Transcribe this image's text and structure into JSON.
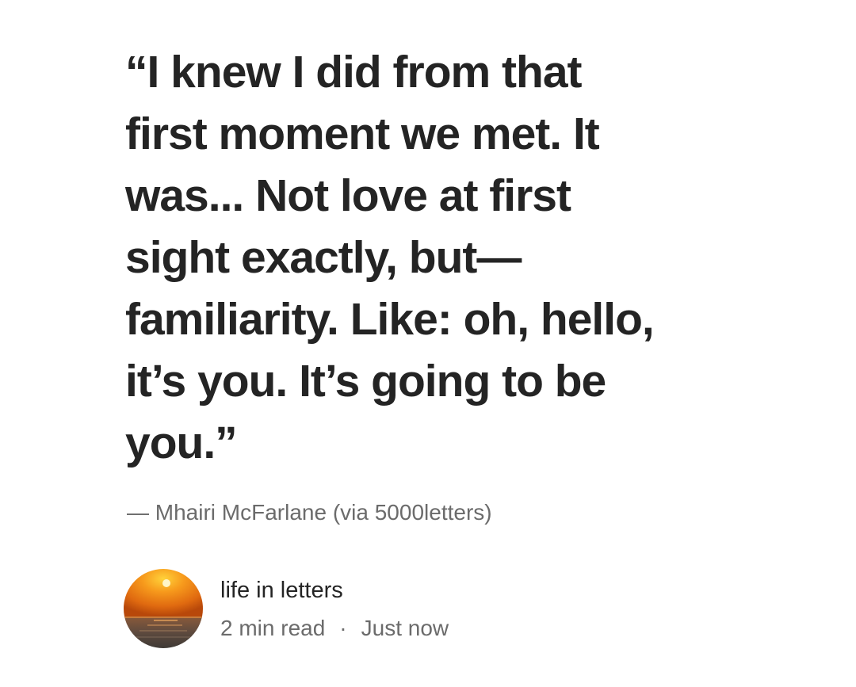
{
  "quote": {
    "lines": [
      "“I knew I did from that",
      "first moment we met. It",
      "was... Not love at first",
      "sight exactly, but—",
      "familiarity. Like: oh, hello,",
      "it’s you. It’s going to be",
      "you.”"
    ]
  },
  "attribution": "— Mhairi McFarlane (via 5000letters)",
  "author": {
    "name": "life in letters",
    "read_time": "2 min read",
    "separator": "·",
    "published": "Just now",
    "avatar_icon": "sunset-avatar-icon"
  },
  "colors": {
    "text_primary": "#242424",
    "text_secondary": "#6b6b6b",
    "background": "#ffffff"
  }
}
